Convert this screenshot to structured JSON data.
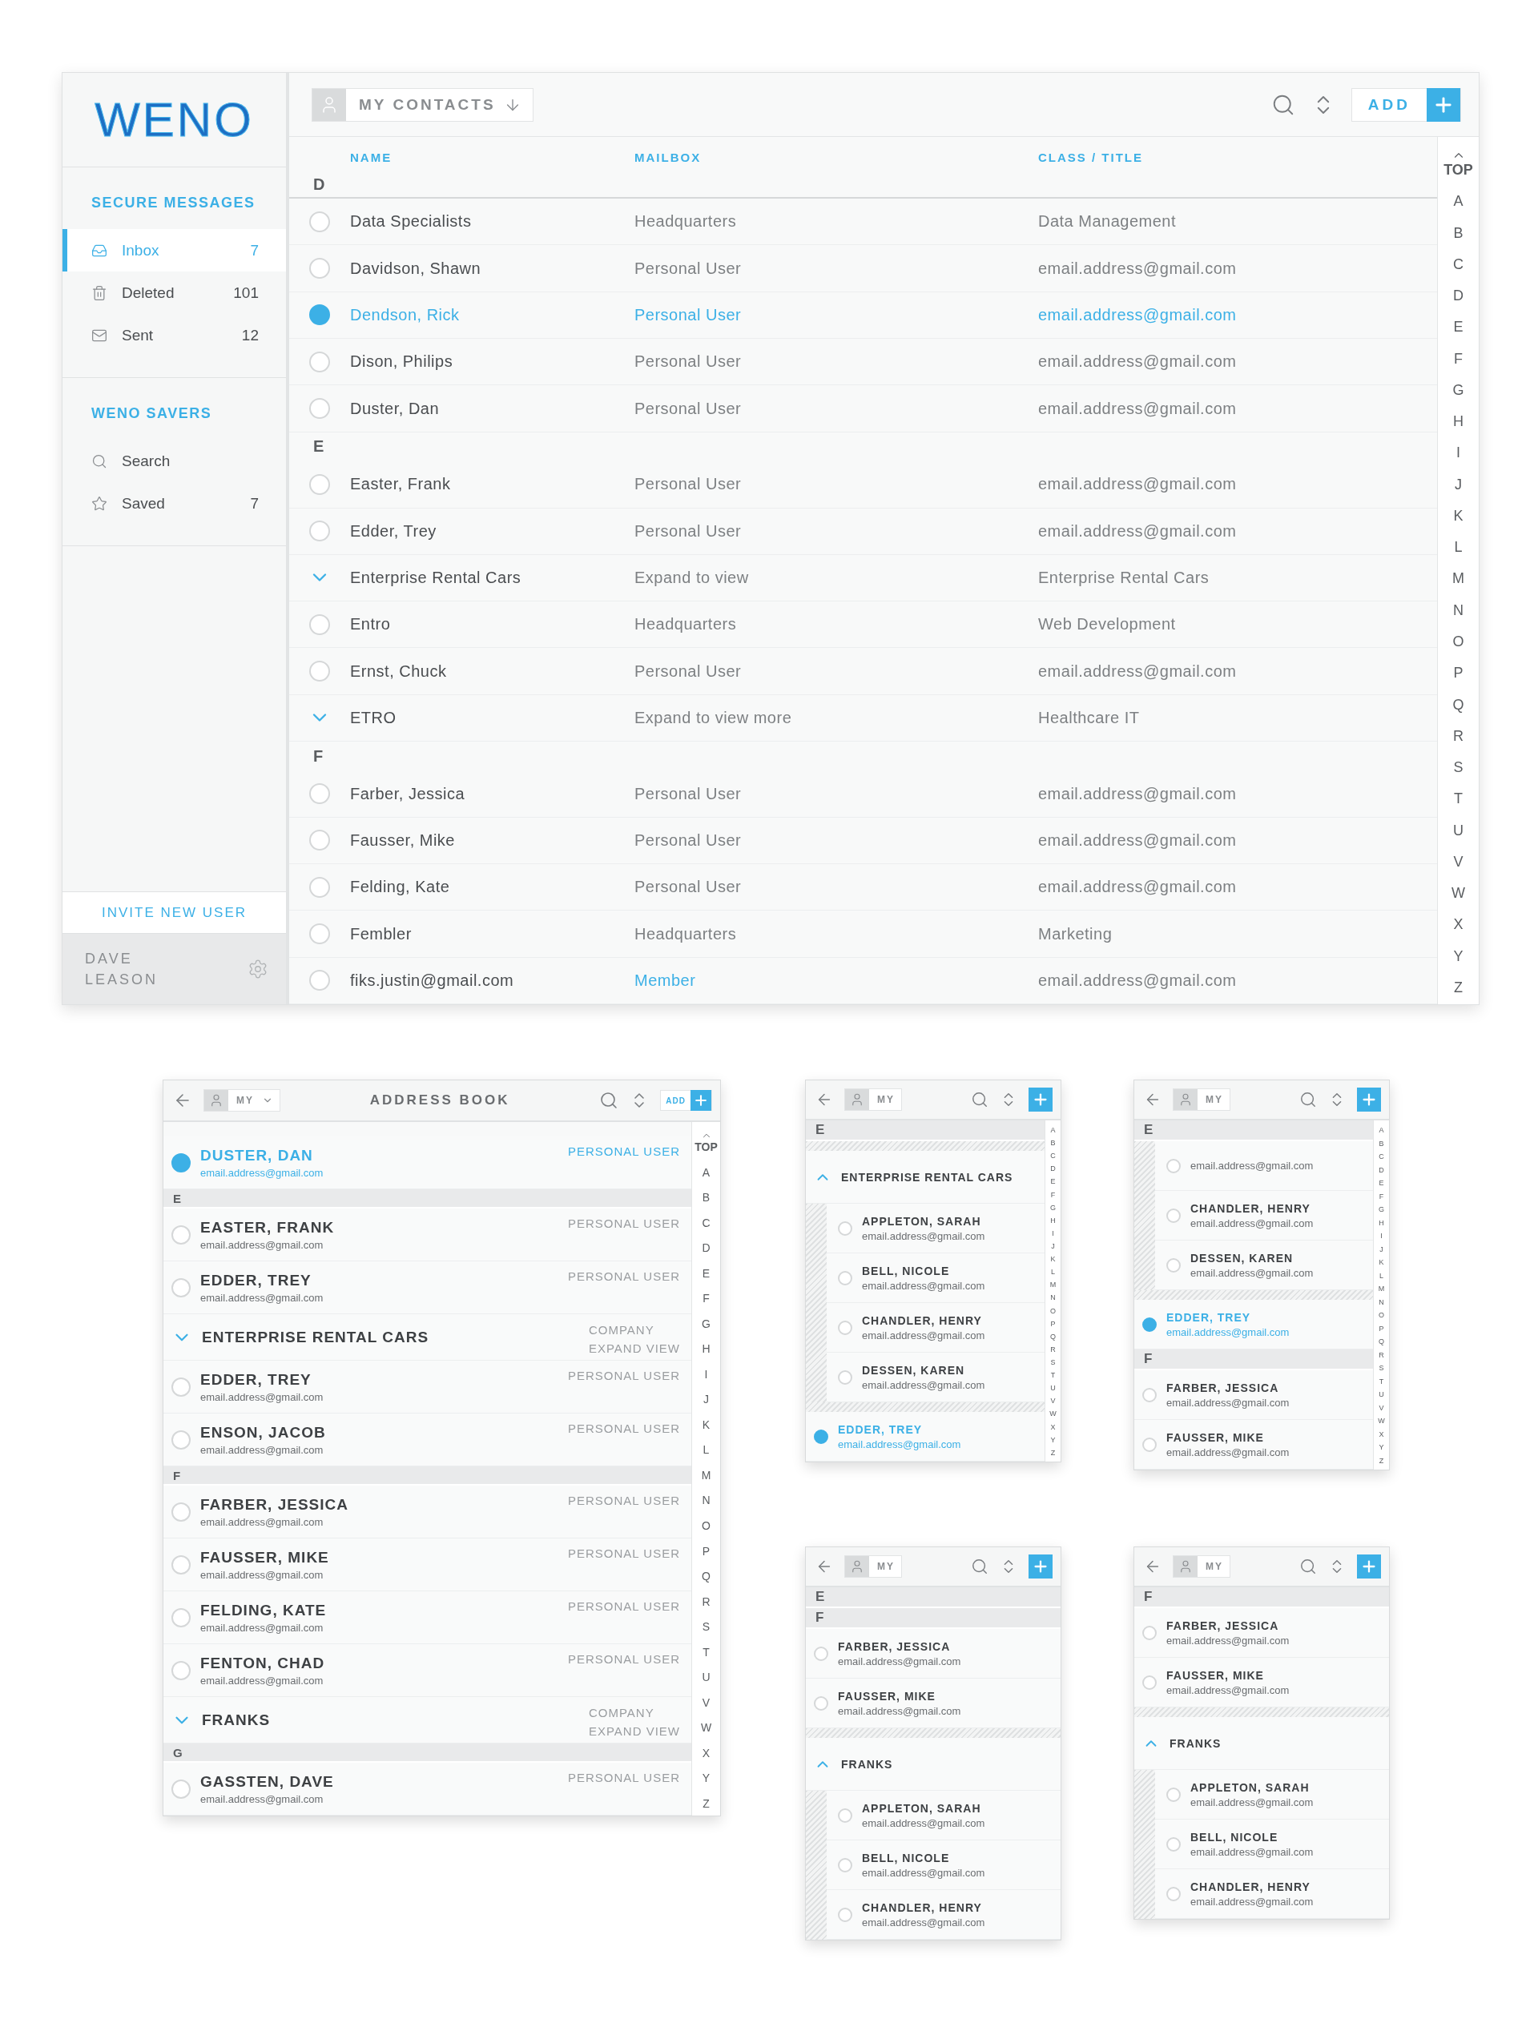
{
  "desktop": {
    "logo": "WENO",
    "sidebar": {
      "sections": [
        {
          "title": "SECURE MESSAGES",
          "items": [
            {
              "label": "Inbox",
              "count": "7",
              "selected": true
            },
            {
              "label": "Deleted",
              "count": "101",
              "selected": false
            },
            {
              "label": "Sent",
              "count": "12",
              "selected": false
            }
          ]
        },
        {
          "title": "WENO SAVERS",
          "items": [
            {
              "label": "Search",
              "selected": false
            },
            {
              "label": "Saved",
              "count": "7",
              "selected": false
            }
          ]
        }
      ],
      "invite": "INVITE NEW USER",
      "user": "DAVE LEASON"
    },
    "toolbar": {
      "filter": "MY CONTACTS",
      "add": "ADD"
    },
    "columns": [
      "NAME",
      "MAILBOX",
      "CLASS / TITLE"
    ],
    "index_top": "TOP",
    "index": [
      "A",
      "B",
      "C",
      "D",
      "E",
      "F",
      "G",
      "H",
      "I",
      "J",
      "K",
      "L",
      "M",
      "N",
      "O",
      "P",
      "Q",
      "R",
      "S",
      "T",
      "U",
      "V",
      "W",
      "X",
      "Y",
      "Z"
    ],
    "rows": [
      {
        "kind": "section",
        "label": "D"
      },
      {
        "kind": "contact",
        "name": "Data Specialists",
        "mailbox": "Headquarters",
        "title": "Data Management",
        "selected": false
      },
      {
        "kind": "contact",
        "name": "Davidson, Shawn",
        "mailbox": "Personal User",
        "title": "email.address@gmail.com",
        "selected": false
      },
      {
        "kind": "contact",
        "name": "Dendson, Rick",
        "mailbox": "Personal User",
        "title": "email.address@gmail.com",
        "selected": true
      },
      {
        "kind": "contact",
        "name": "Dison, Philips",
        "mailbox": "Personal User",
        "title": "email.address@gmail.com",
        "selected": false
      },
      {
        "kind": "contact",
        "name": "Duster, Dan",
        "mailbox": "Personal User",
        "title": "email.address@gmail.com",
        "selected": false
      },
      {
        "kind": "section",
        "label": "E"
      },
      {
        "kind": "contact",
        "name": "Easter, Frank",
        "mailbox": "Personal User",
        "title": "email.address@gmail.com",
        "selected": false
      },
      {
        "kind": "contact",
        "name": "Edder, Trey",
        "mailbox": "Personal User",
        "title": "email.address@gmail.com",
        "selected": false
      },
      {
        "kind": "company",
        "name": "Enterprise Rental Cars",
        "mailbox": "Expand to view",
        "title": "Enterprise Rental Cars",
        "expanded": false
      },
      {
        "kind": "contact",
        "name": "Entro",
        "mailbox": "Headquarters",
        "title": "Web Development",
        "selected": false
      },
      {
        "kind": "contact",
        "name": "Ernst, Chuck",
        "mailbox": "Personal User",
        "title": "email.address@gmail.com",
        "selected": false
      },
      {
        "kind": "company",
        "name": "ETRO",
        "mailbox": "Expand to view more",
        "title": "Healthcare IT",
        "expanded": false
      },
      {
        "kind": "section",
        "label": "F"
      },
      {
        "kind": "contact",
        "name": "Farber, Jessica",
        "mailbox": "Personal User",
        "title": "email.address@gmail.com",
        "selected": false
      },
      {
        "kind": "contact",
        "name": "Fausser, Mike",
        "mailbox": "Personal User",
        "title": "email.address@gmail.com",
        "selected": false
      },
      {
        "kind": "contact",
        "name": "Felding, Kate",
        "mailbox": "Personal User",
        "title": "email.address@gmail.com",
        "selected": false
      },
      {
        "kind": "contact",
        "name": "Fembler",
        "mailbox": "Headquarters",
        "title": "Marketing",
        "selected": false
      },
      {
        "kind": "member",
        "name": "fiks.justin@gmail.com",
        "mailbox": "Member",
        "title": "email.address@gmail.com",
        "selected": false
      }
    ]
  },
  "panels": [
    {
      "title": "ADDRESS BOOK",
      "filter": "MY",
      "add": "ADD",
      "index_top": "TOP",
      "index": [
        "A",
        "B",
        "C",
        "D",
        "E",
        "F",
        "G",
        "H",
        "I",
        "J",
        "K",
        "L",
        "M",
        "N",
        "O",
        "P",
        "Q",
        "R",
        "S",
        "T",
        "U",
        "V",
        "W",
        "X",
        "Y",
        "Z"
      ],
      "rows": [
        {
          "kind": "contact",
          "name": "DUSTER, DAN",
          "email": "email.address@gmail.com",
          "role": "PERSONAL USER",
          "selected": true
        },
        {
          "kind": "section",
          "label": "E"
        },
        {
          "kind": "contact",
          "name": "EASTER, FRANK",
          "email": "email.address@gmail.com",
          "role": "PERSONAL USER",
          "selected": false
        },
        {
          "kind": "contact",
          "name": "EDDER, TREY",
          "email": "email.address@gmail.com",
          "role": "PERSONAL USER",
          "selected": false
        },
        {
          "kind": "company",
          "name": "ENTERPRISE RENTAL CARS",
          "tags": [
            "COMPANY",
            "EXPAND VIEW"
          ],
          "expanded": false
        },
        {
          "kind": "contact",
          "name": "EDDER, TREY",
          "email": "email.address@gmail.com",
          "role": "PERSONAL USER",
          "selected": false
        },
        {
          "kind": "contact",
          "name": "ENSON, JACOB",
          "email": "email.address@gmail.com",
          "role": "PERSONAL USER",
          "selected": false
        },
        {
          "kind": "section",
          "label": "F"
        },
        {
          "kind": "contact",
          "name": "FARBER, JESSICA",
          "email": "email.address@gmail.com",
          "role": "PERSONAL USER",
          "selected": false
        },
        {
          "kind": "contact",
          "name": "FAUSSER, MIKE",
          "email": "email.address@gmail.com",
          "role": "PERSONAL USER",
          "selected": false
        },
        {
          "kind": "contact",
          "name": "FELDING, KATE",
          "email": "email.address@gmail.com",
          "role": "PERSONAL USER",
          "selected": false
        },
        {
          "kind": "contact",
          "name": "FENTON, CHAD",
          "email": "email.address@gmail.com",
          "role": "PERSONAL USER",
          "selected": false
        },
        {
          "kind": "company",
          "name": "FRANKS",
          "tags": [
            "COMPANY",
            "EXPAND VIEW"
          ],
          "expanded": false
        },
        {
          "kind": "section",
          "label": "G"
        },
        {
          "kind": "contact",
          "name": "GASSTEN, DAVE",
          "email": "email.address@gmail.com",
          "role": "PERSONAL USER",
          "selected": false
        }
      ]
    },
    {
      "filter": "MY",
      "index": [
        "A",
        "B",
        "C",
        "D",
        "E",
        "F",
        "G",
        "H",
        "I",
        "J",
        "K",
        "L",
        "M",
        "N",
        "O",
        "P",
        "Q",
        "R",
        "S",
        "T",
        "U",
        "V",
        "W",
        "X",
        "Y",
        "Z"
      ],
      "rows": [
        {
          "kind": "section",
          "label": "E"
        },
        {
          "kind": "divider"
        },
        {
          "kind": "company",
          "name": "ENTERPRISE RENTAL CARS",
          "expanded": true,
          "children": [
            {
              "kind": "contact",
              "name": "APPLETON, SARAH",
              "email": "email.address@gmail.com",
              "selected": false
            },
            {
              "kind": "contact",
              "name": "BELL, NICOLE",
              "email": "email.address@gmail.com",
              "selected": false
            },
            {
              "kind": "contact",
              "name": "CHANDLER, HENRY",
              "email": "email.address@gmail.com",
              "selected": false
            },
            {
              "kind": "contact",
              "name": "DESSEN, KAREN",
              "email": "email.address@gmail.com",
              "selected": false
            }
          ]
        },
        {
          "kind": "divider"
        },
        {
          "kind": "contact",
          "name": "EDDER, TREY",
          "email": "email.address@gmail.com",
          "selected": true
        }
      ]
    },
    {
      "filter": "MY",
      "index": [
        "A",
        "B",
        "C",
        "D",
        "E",
        "F",
        "G",
        "H",
        "I",
        "J",
        "K",
        "L",
        "M",
        "N",
        "O",
        "P",
        "Q",
        "R",
        "S",
        "T",
        "U",
        "V",
        "W",
        "X",
        "Y",
        "Z"
      ],
      "rows": [
        {
          "kind": "section",
          "label": "E"
        },
        {
          "kind": "subgroup",
          "children": [
            {
              "kind": "contact",
              "email": "email.address@gmail.com",
              "selected": false
            },
            {
              "kind": "contact",
              "name": "CHANDLER, HENRY",
              "email": "email.address@gmail.com",
              "selected": false
            },
            {
              "kind": "contact",
              "name": "DESSEN, KAREN",
              "email": "email.address@gmail.com",
              "selected": false
            }
          ]
        },
        {
          "kind": "divider"
        },
        {
          "kind": "contact",
          "name": "EDDER, TREY",
          "email": "email.address@gmail.com",
          "selected": true
        },
        {
          "kind": "section",
          "label": "F"
        },
        {
          "kind": "contact",
          "name": "FARBER, JESSICA",
          "email": "email.address@gmail.com",
          "selected": false
        },
        {
          "kind": "contact",
          "name": "FAUSSER, MIKE",
          "email": "email.address@gmail.com",
          "selected": false
        }
      ]
    },
    {
      "filter": "MY",
      "rows": [
        {
          "kind": "section",
          "label": "E"
        },
        {
          "kind": "section",
          "label": "F"
        },
        {
          "kind": "contact",
          "name": "FARBER, JESSICA",
          "email": "email.address@gmail.com",
          "selected": false
        },
        {
          "kind": "contact",
          "name": "FAUSSER, MIKE",
          "email": "email.address@gmail.com",
          "selected": false
        },
        {
          "kind": "divider"
        },
        {
          "kind": "company",
          "name": "FRANKS",
          "expanded": true,
          "children": [
            {
              "kind": "contact",
              "name": "APPLETON, SARAH",
              "email": "email.address@gmail.com",
              "selected": false
            },
            {
              "kind": "contact",
              "name": "BELL, NICOLE",
              "email": "email.address@gmail.com",
              "selected": false
            },
            {
              "kind": "contact",
              "name": "CHANDLER, HENRY",
              "email": "email.address@gmail.com",
              "selected": false
            }
          ]
        }
      ]
    },
    {
      "filter": "MY",
      "rows": [
        {
          "kind": "section",
          "label": "F"
        },
        {
          "kind": "contact",
          "name": "FARBER, JESSICA",
          "email": "email.address@gmail.com",
          "selected": false
        },
        {
          "kind": "contact",
          "name": "FAUSSER, MIKE",
          "email": "email.address@gmail.com",
          "selected": false
        },
        {
          "kind": "divider"
        },
        {
          "kind": "company",
          "name": "FRANKS",
          "expanded": true,
          "children": [
            {
              "kind": "contact",
              "name": "APPLETON, SARAH",
              "email": "email.address@gmail.com",
              "selected": false
            },
            {
              "kind": "contact",
              "name": "BELL, NICOLE",
              "email": "email.address@gmail.com",
              "selected": false
            },
            {
              "kind": "contact",
              "name": "CHANDLER, HENRY",
              "email": "email.address@gmail.com",
              "selected": false
            }
          ]
        }
      ]
    }
  ]
}
